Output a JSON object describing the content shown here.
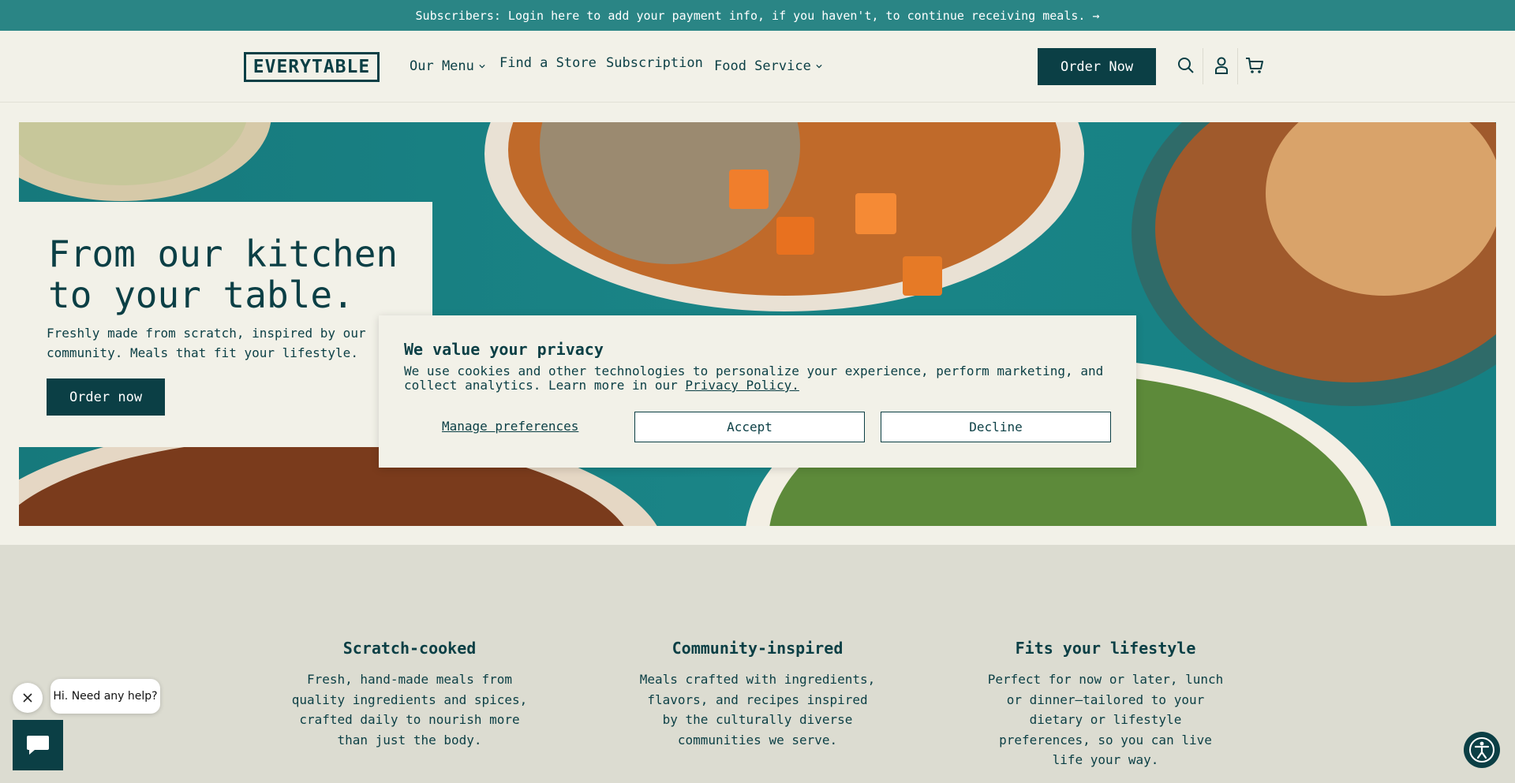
{
  "announcement": {
    "text": "Subscribers: Login here to add your payment info, if you haven't, to continue receiving meals. →"
  },
  "header": {
    "logo": "EVERYTABLE",
    "nav": [
      {
        "label": "Our Menu",
        "has_dropdown": true
      },
      {
        "label": "Find a Store",
        "has_dropdown": false
      },
      {
        "label": "Subscription",
        "has_dropdown": false
      },
      {
        "label": "Food Service",
        "has_dropdown": true
      }
    ],
    "order_button": "Order Now",
    "icons": [
      "search-icon",
      "account-icon",
      "cart-icon"
    ]
  },
  "hero": {
    "title": "From our kitchen to your table.",
    "subtitle": "Freshly made from scratch, inspired by our community. Meals that fit your lifestyle.",
    "button": "Order now"
  },
  "privacy": {
    "title": "We value your privacy",
    "body": "We use cookies and other technologies to personalize your experience, perform marketing, and collect analytics. Learn more in our",
    "link": "Privacy Policy.",
    "manage": "Manage preferences",
    "accept": "Accept",
    "decline": "Decline"
  },
  "features": [
    {
      "title": "Scratch-cooked",
      "text": "Fresh, hand-made meals from quality ingredients and spices, crafted daily to nourish more than just the body."
    },
    {
      "title": "Community-inspired",
      "text": "Meals crafted with ingredients, flavors, and recipes inspired by the culturally diverse communities we serve."
    },
    {
      "title": "Fits your lifestyle",
      "text": "Perfect for now or later, lunch or dinner—tailored to your dietary or lifestyle preferences, so you can live life your way."
    }
  ],
  "chat": {
    "greeting": "Hi. Need any help?"
  },
  "colors": {
    "brand": "#0b3f45",
    "teal": "#2a8585",
    "background": "#f2f1e8",
    "features_bg": "#dcdcd1"
  }
}
